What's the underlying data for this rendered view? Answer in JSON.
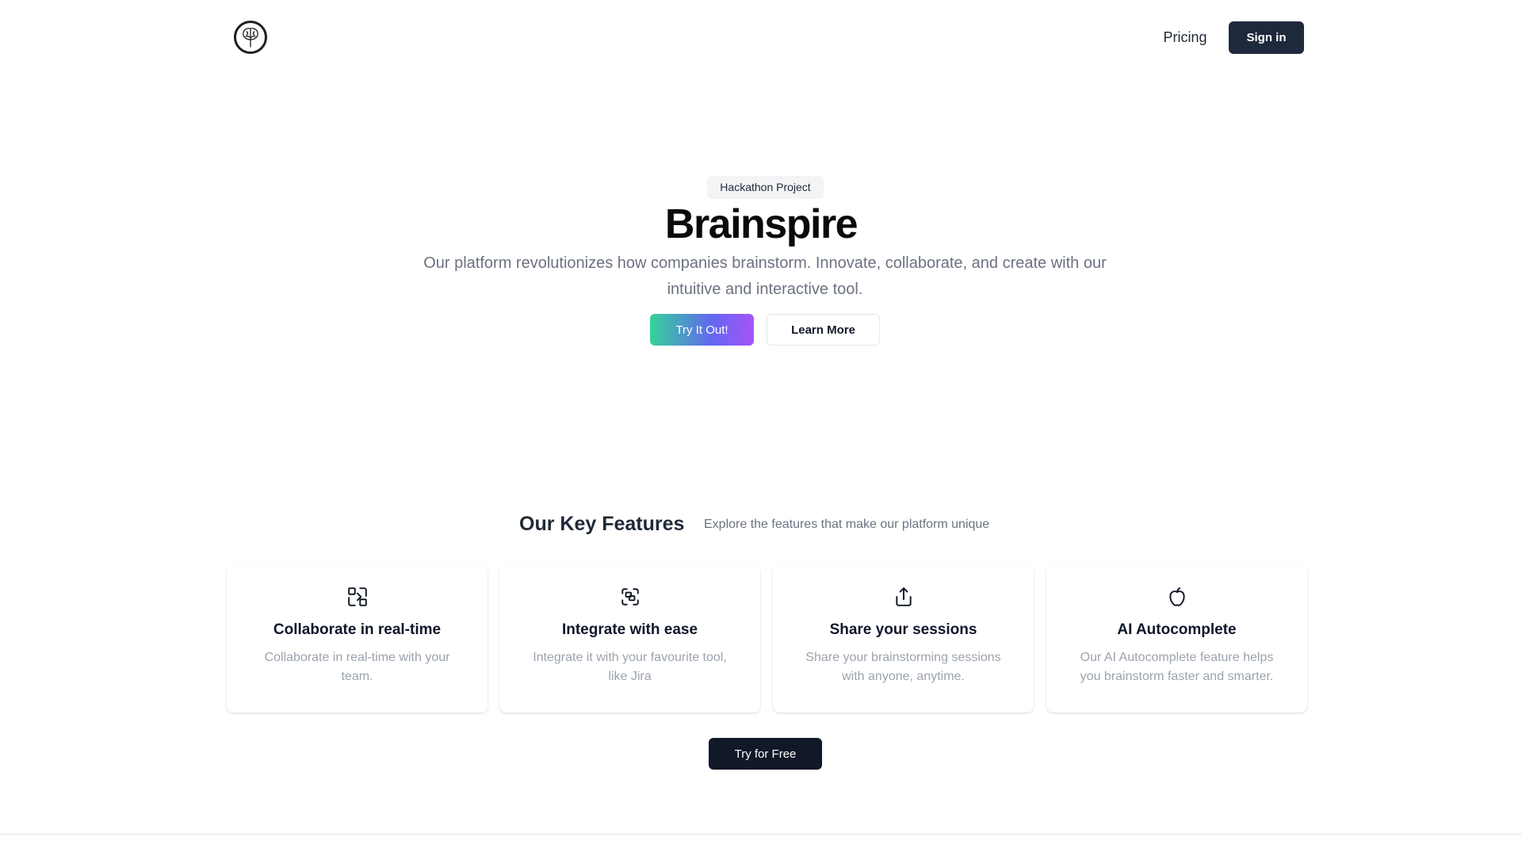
{
  "header": {
    "logo_icon": "brain-tree-icon",
    "nav_pricing": "Pricing",
    "signin_label": "Sign in"
  },
  "hero": {
    "badge": "Hackathon Project",
    "title": "Brainspire",
    "subtitle": "Our platform revolutionizes how companies brainstorm. Innovate, collaborate, and create with our intuitive and interactive tool.",
    "primary_cta": "Try It Out!",
    "secondary_cta": "Learn More",
    "gradient_colors": [
      "#34d399",
      "#6366f1",
      "#a855f7"
    ]
  },
  "features": {
    "title": "Our Key Features",
    "subtitle": "Explore the features that make our platform unique",
    "items": [
      {
        "icon": "collaborate-icon",
        "title": "Collaborate in real-time",
        "description": "Collaborate in real-time with your team."
      },
      {
        "icon": "integrate-icon",
        "title": "Integrate with ease",
        "description": "Integrate it with your favourite tool, like Jira"
      },
      {
        "icon": "share-icon",
        "title": "Share your sessions",
        "description": "Share your brainstorming sessions with anyone, anytime."
      },
      {
        "icon": "apple-icon",
        "title": "AI Autocomplete",
        "description": "Our AI Autocomplete feature helps you brainstorm faster and smarter."
      }
    ],
    "cta": "Try for Free"
  },
  "colors": {
    "primary_dark": "#1e293b",
    "cta_dark": "#111827",
    "muted_text": "#6b7280"
  }
}
